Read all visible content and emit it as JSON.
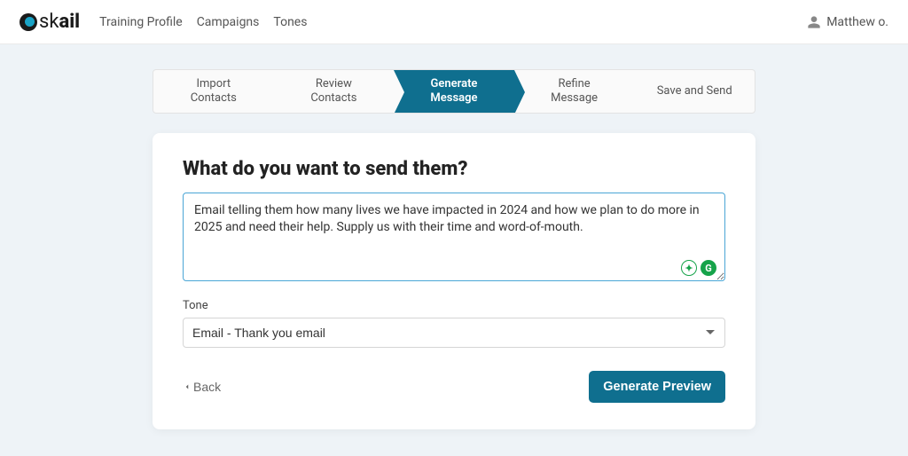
{
  "brand": {
    "text_thin": "sk",
    "text_bold": "ail"
  },
  "nav": {
    "training_profile": "Training Profile",
    "campaigns": "Campaigns",
    "tones": "Tones"
  },
  "user": {
    "name": "Matthew o."
  },
  "stepper": {
    "import": "Import Contacts",
    "review": "Review Contacts",
    "generate": "Generate Message",
    "refine": "Refine Message",
    "save": "Save and Send"
  },
  "card": {
    "heading": "What do you want to send them?",
    "message_value": "Email telling them how many lives we have impacted in 2024 and how we plan to do more in 2025 and need their help. Supply us with their time and word-of-mouth.",
    "tone_label": "Tone",
    "tone_selected": "Email - Thank you email",
    "back": "Back",
    "generate_preview": "Generate Preview"
  }
}
